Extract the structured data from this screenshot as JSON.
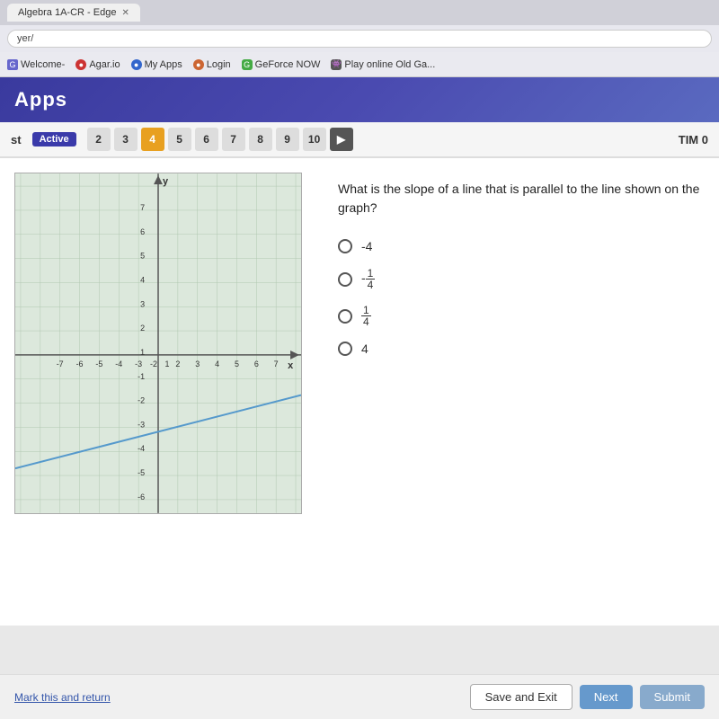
{
  "browser": {
    "tab_label": "Algebra 1A-CR - Edge",
    "address": "yer/",
    "bookmarks": [
      {
        "id": "welcome",
        "label": "Welcome-",
        "icon": "G",
        "class": "bm-welcome"
      },
      {
        "id": "agar",
        "label": "Agar.io",
        "icon": "●",
        "class": "bm-agar"
      },
      {
        "id": "myapps",
        "label": "My Apps",
        "icon": "●",
        "class": "bm-myapps"
      },
      {
        "id": "login",
        "label": "Login",
        "icon": "●",
        "class": "bm-login"
      },
      {
        "id": "geforce",
        "label": "GeForce NOW",
        "icon": "G",
        "class": "bm-geforce"
      },
      {
        "id": "playold",
        "label": "Play online Old Ga...",
        "icon": "👾",
        "class": "bm-playold"
      }
    ]
  },
  "app": {
    "header_title": "Apps"
  },
  "question_bar": {
    "status": "st",
    "active_label": "Active",
    "questions": [
      "2",
      "3",
      "4",
      "5",
      "6",
      "7",
      "8",
      "9",
      "10"
    ],
    "active_q": "4",
    "timer_label": "TIM",
    "timer_value": "0"
  },
  "question": {
    "text": "What is the slope of a line that is parallel to the line shown on the graph?",
    "options": [
      {
        "id": "opt1",
        "label": "-4",
        "type": "plain"
      },
      {
        "id": "opt2",
        "label": "neg_quarter",
        "type": "fraction",
        "num": "-1",
        "den": "4"
      },
      {
        "id": "opt3",
        "label": "pos_quarter",
        "type": "fraction",
        "num": "1",
        "den": "4"
      },
      {
        "id": "opt4",
        "label": "4",
        "type": "plain"
      }
    ]
  },
  "graph": {
    "x_label": "x",
    "y_label": "y",
    "x_min": -7,
    "x_max": 7,
    "y_min": -7,
    "y_max": 7
  },
  "bottom": {
    "mark_return": "Mark this and return",
    "save_exit": "Save and Exit",
    "next": "Next",
    "submit": "Submit"
  }
}
